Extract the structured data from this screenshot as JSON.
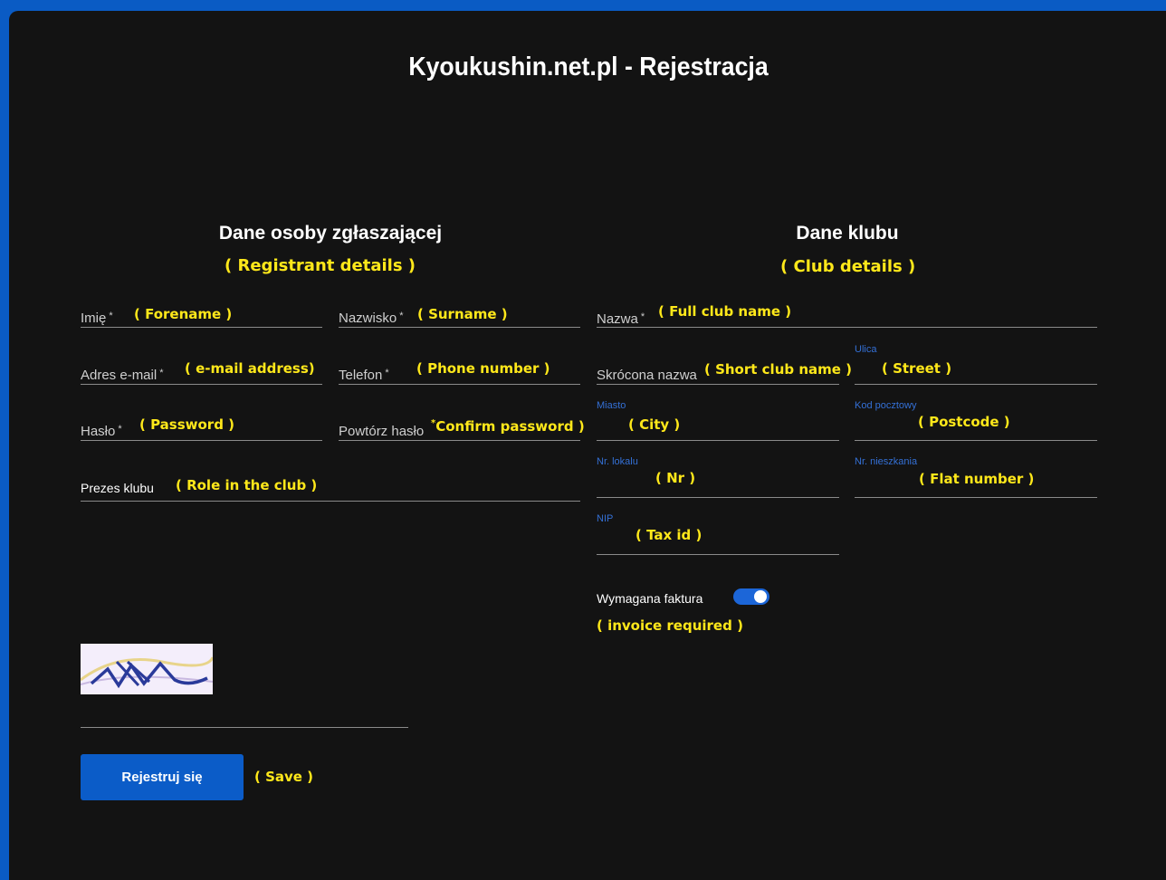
{
  "title": "Kyoukushin.net.pl - Rejestracja",
  "left_section": {
    "title": "Dane osoby zgłaszającej",
    "annotation": "( Registrant details )"
  },
  "right_section": {
    "title": "Dane klubu",
    "annotation": "( Club details )"
  },
  "fields": {
    "forename": {
      "label": "Imię",
      "required": "*",
      "annotation": "( Forename )"
    },
    "surname": {
      "label": "Nazwisko",
      "required": "*",
      "annotation": "( Surname )"
    },
    "email": {
      "label": "Adres e-mail",
      "required": "*",
      "annotation": "( e-mail address)"
    },
    "phone": {
      "label": "Telefon",
      "required": "*",
      "annotation": "( Phone number )"
    },
    "password": {
      "label": "Hasło",
      "required": "*",
      "annotation": "( Password )"
    },
    "confirm_password": {
      "label": "Powtórz hasło",
      "required": "*",
      "annotation": "Confirm password )"
    },
    "role": {
      "label": "Prezes klubu",
      "annotation": "( Role in the club )"
    },
    "club_name": {
      "label": "Nazwa",
      "required": "*",
      "annotation": "( Full club name )"
    },
    "short_name": {
      "label": "Skrócona nazwa",
      "annotation": "( Short club name )"
    },
    "street": {
      "label": "Ulica",
      "annotation": "( Street )"
    },
    "city": {
      "label": "Miasto",
      "annotation": "( City )"
    },
    "postcode": {
      "label": "Kod pocztowy",
      "annotation": "( Postcode )"
    },
    "nr": {
      "label": "Nr. lokalu",
      "annotation": "( Nr )"
    },
    "flat": {
      "label": "Nr. nieszkania",
      "annotation": "( Flat number )"
    },
    "tax": {
      "label": "NIP",
      "annotation": "( Tax id )"
    }
  },
  "invoice": {
    "label": "Wymagana faktura",
    "annotation": "( invoice required )",
    "enabled": true
  },
  "captcha": {
    "text": "bTXte"
  },
  "submit": {
    "label": "Rejestruj się",
    "annotation": "( Save )"
  },
  "colors": {
    "accent": "#0b5cc8",
    "annotation": "#ffe81a",
    "background": "#131313"
  }
}
